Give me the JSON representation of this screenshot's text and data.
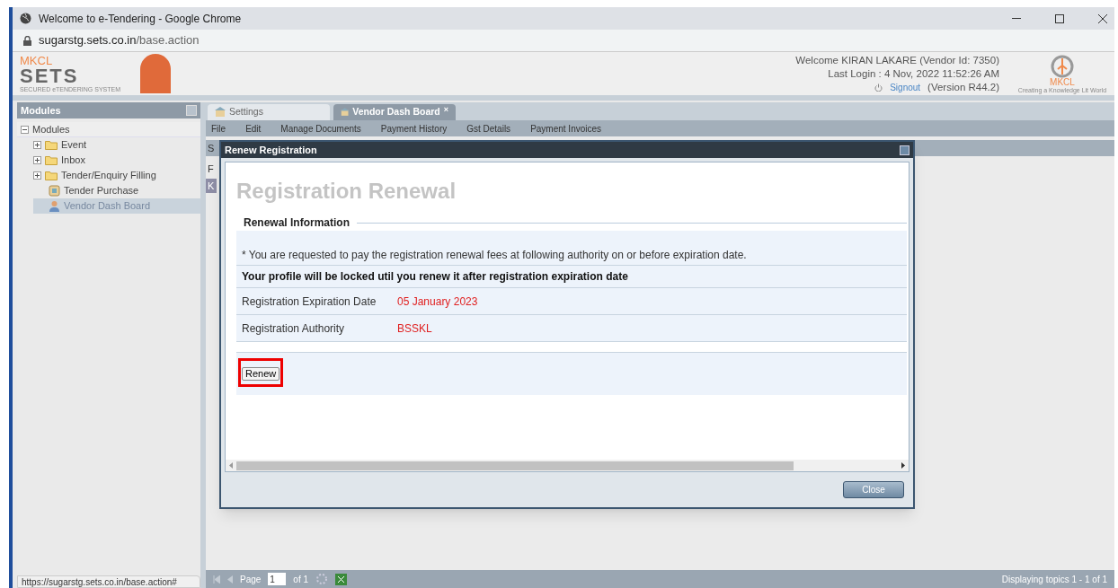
{
  "browser": {
    "title": "Welcome to e-Tendering - Google Chrome",
    "url_host": "sugarstg.sets.co.in",
    "url_path": "/base.action",
    "status_url": "https://sugarstg.sets.co.in/base.action#"
  },
  "header": {
    "logo_top": "MKCL",
    "logo_main": "SETS",
    "logo_tag": "SECURED eTENDERING SYSTEM",
    "welcome": "Welcome KIRAN LAKARE (Vendor Id: 7350)",
    "last_login": "Last Login : 4 Nov, 2022 11:52:26 AM",
    "signout": "Signout",
    "version": "(Version R44.2)",
    "right_logo": "MKCL",
    "right_tag": "Creating a Knowledge Lit World"
  },
  "sidebar": {
    "title": "Modules",
    "tree": [
      {
        "label": "Modules",
        "kind": "root",
        "expanded": true,
        "selected": false,
        "children": [
          {
            "label": "Event",
            "kind": "folder",
            "expanded": false,
            "selected": false
          },
          {
            "label": "Inbox",
            "kind": "folder",
            "expanded": false,
            "selected": false
          },
          {
            "label": "Tender/Enquiry Filling",
            "kind": "folder",
            "expanded": false,
            "selected": false
          },
          {
            "label": "Tender Purchase",
            "kind": "page",
            "selected": false
          },
          {
            "label": "Vendor Dash Board",
            "kind": "user",
            "selected": true
          }
        ]
      }
    ]
  },
  "tabs": [
    {
      "label": "Settings",
      "selected": false
    },
    {
      "label": "Vendor Dash Board",
      "selected": true,
      "close": "×"
    }
  ],
  "toolbar": [
    "File",
    "Edit",
    "Manage Documents",
    "Payment History",
    "Gst Details",
    "Payment Invoices"
  ],
  "content_fragments": [
    "S",
    "F",
    "K"
  ],
  "pager": {
    "page_label": "Page",
    "page_value": "1",
    "of_label": "of 1",
    "display": "Displaying topics 1 - 1 of 1"
  },
  "dialog": {
    "title": "Renew Registration",
    "heading": "Registration Renewal",
    "section_title": "Renewal Information",
    "notice": "* You are requested to pay the registration renewal fees at following authority on or before expiration date.",
    "warning": "Your profile will be locked util you renew it after registration expiration date",
    "fields": [
      {
        "label": "Registration Expiration Date",
        "value": "05 January 2023"
      },
      {
        "label": "Registration Authority",
        "value": "BSSKL"
      }
    ],
    "renew_button": "Renew",
    "close_button": "Close"
  }
}
